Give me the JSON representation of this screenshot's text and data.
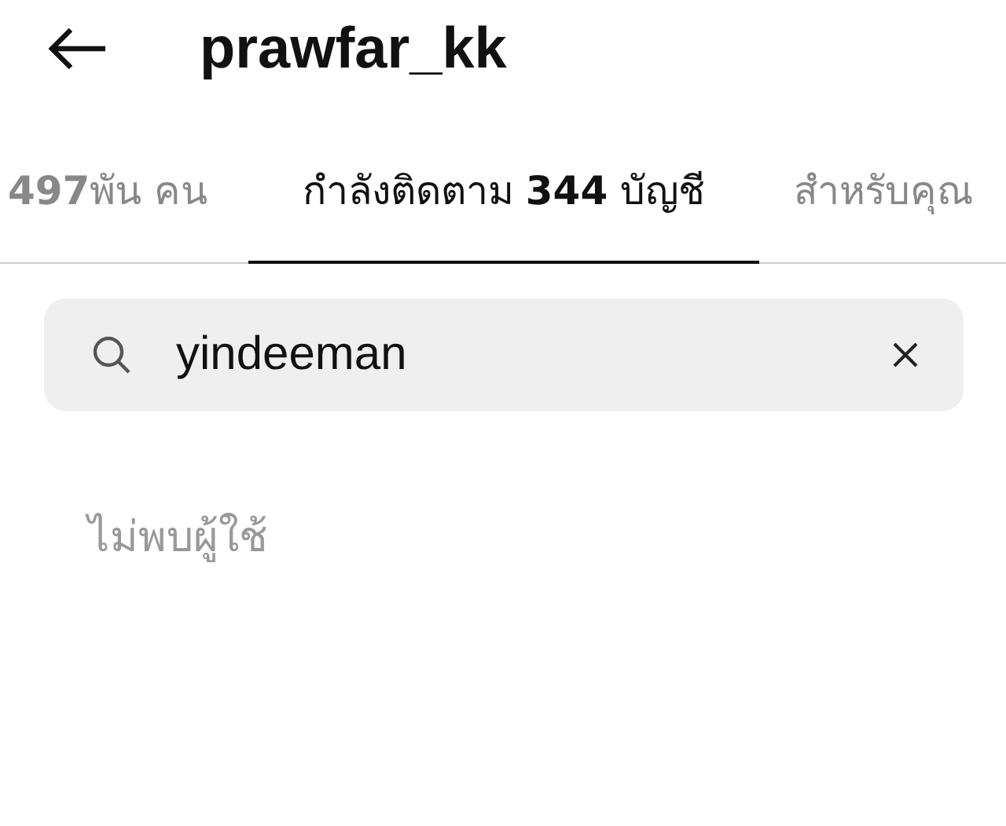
{
  "header": {
    "username": "prawfar_kk"
  },
  "tabs": [
    {
      "label": "**497**พัน คน",
      "selected": false
    },
    {
      "label": "กำลังติดตาม **344** บัญชี",
      "selected": true
    },
    {
      "label": "สำหรับคุณ",
      "selected": false
    }
  ],
  "search": {
    "value": "yindeeman"
  },
  "empty_message": "ไม่พบผู้ใช้"
}
